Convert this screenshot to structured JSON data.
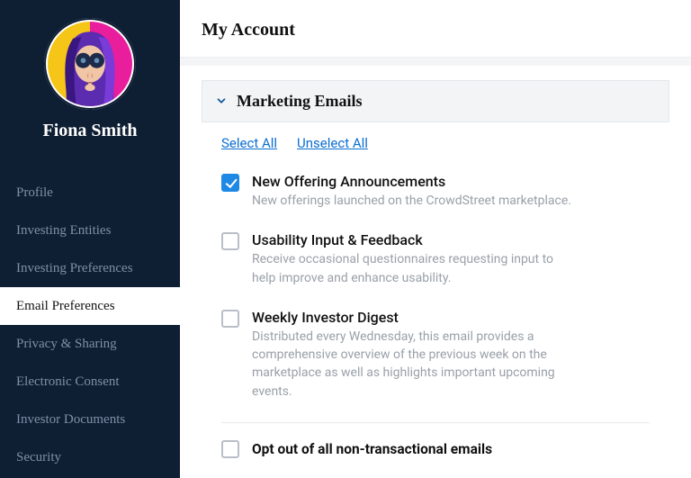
{
  "user": {
    "name": "Fiona Smith"
  },
  "sidebar": {
    "items": [
      {
        "label": "Profile",
        "active": false
      },
      {
        "label": "Investing Entities",
        "active": false
      },
      {
        "label": "Investing Preferences",
        "active": false
      },
      {
        "label": "Email Preferences",
        "active": true
      },
      {
        "label": "Privacy & Sharing",
        "active": false
      },
      {
        "label": "Electronic Consent",
        "active": false
      },
      {
        "label": "Investor Documents",
        "active": false
      },
      {
        "label": "Security",
        "active": false
      }
    ]
  },
  "page": {
    "title": "My Account"
  },
  "section": {
    "title": "Marketing Emails",
    "select_all": "Select All",
    "unselect_all": "Unselect All",
    "options": [
      {
        "label": "New Offering Announcements",
        "desc": "New offerings launched on the CrowdStreet marketplace.",
        "checked": true
      },
      {
        "label": "Usability Input & Feedback",
        "desc": "Receive occasional questionnaires requesting input to help improve and enhance usability.",
        "checked": false
      },
      {
        "label": "Weekly Investor Digest",
        "desc": "Distributed every Wednesday, this email provides a comprehensive overview of the previous week on the marketplace as well as highlights important upcoming events.",
        "checked": false
      }
    ],
    "optout": {
      "label": "Opt out of all non-transactional emails",
      "checked": false
    }
  }
}
